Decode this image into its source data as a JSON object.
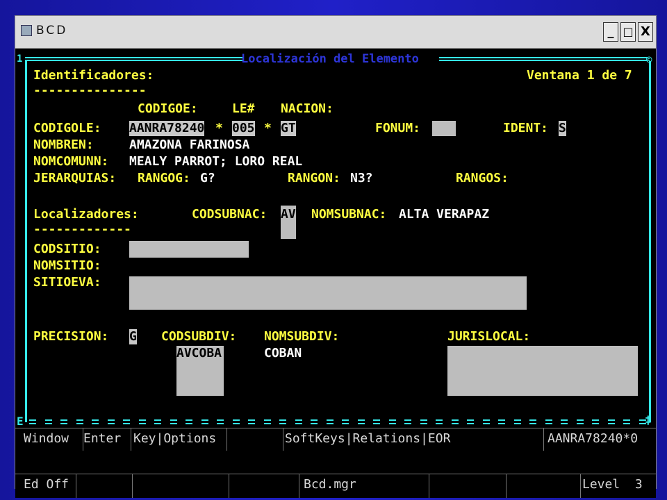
{
  "window": {
    "title": "BCD",
    "minimize": "_",
    "maximize": "□",
    "close": "X"
  },
  "header": {
    "title": "Localización del Elemento",
    "section": "Identificadores:",
    "underline": "---------------",
    "window_info": "Ventana 1 de 7"
  },
  "fields": {
    "codigoe_label": "CODIGOE:",
    "le_label": "LE#",
    "nacion_label": "NACION:",
    "codigole_label": "CODIGOLE:",
    "codigoe_value": "AANRA78240",
    "sep1": "*",
    "le_value": "005",
    "sep2": "*",
    "nacion_value": "GT",
    "fonum_label": "FONUM:",
    "fonum_value": "",
    "ident_label": "IDENT:",
    "ident_value": "S",
    "nombren_label": "NOMBREN:",
    "nombren_value": "AMAZONA FARINOSA",
    "nomcomunn_label": "NOMCOMUNN:",
    "nomcomunn_value": "MEALY PARROT; LORO REAL",
    "jerarquias_label": "JERARQUIAS:",
    "rangog_label": "RANGOG:",
    "rangog_value": "G?",
    "rangon_label": "RANGON:",
    "rangon_value": "N3?",
    "rangos_label": "RANGOS:"
  },
  "localizadores": {
    "section": "Localizadores:",
    "underline": "-------------",
    "codsubnac_label": "CODSUBNAC:",
    "codsubnac_value": "AV",
    "nomsubnac_label": "NOMSUBNAC:",
    "nomsubnac_value": "ALTA VERAPAZ",
    "codsitio_label": "CODSITIO:",
    "nomsitio_label": "NOMSITIO:",
    "sitioeva_label": "SITIOEVA:",
    "precision_label": "PRECISION:",
    "precision_value": "G",
    "codsubdiv_label": "CODSUBDIV:",
    "codsubdiv_value": "AVCOBA",
    "nomsubdiv_label": "NOMSUBDIV:",
    "nomsubdiv_value": "COBAN",
    "jurislocal_label": "JURISLOCAL:"
  },
  "menu": [
    "Window",
    "Enter",
    "Key|Options",
    "",
    "SoftKeys|Relations|EOR",
    "AANRA78240*0"
  ],
  "status": [
    "Ed Off",
    "",
    "",
    "",
    "Bcd.mgr",
    "",
    "",
    "Level  3"
  ]
}
